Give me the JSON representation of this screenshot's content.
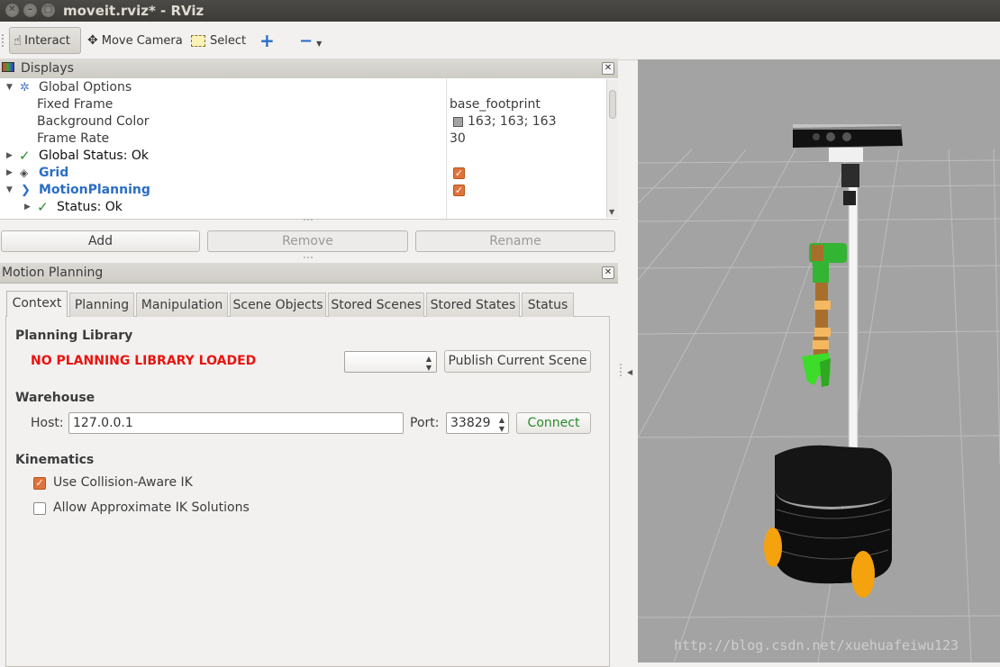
{
  "window": {
    "title": "moveit.rviz* - RViz"
  },
  "toolbar": {
    "interact": "Interact",
    "move_camera": "Move Camera",
    "select": "Select"
  },
  "displays": {
    "header": "Displays",
    "rows": {
      "global_options": "Global Options",
      "fixed_frame": {
        "label": "Fixed Frame",
        "value": "base_footprint"
      },
      "background_color": {
        "label": "Background Color",
        "value": "163; 163; 163",
        "swatch": "#a3a3a3"
      },
      "frame_rate": {
        "label": "Frame Rate",
        "value": "30"
      },
      "global_status": "Global Status: Ok",
      "grid": "Grid",
      "motion_planning": "MotionPlanning",
      "status": "Status: Ok"
    },
    "buttons": {
      "add": "Add",
      "remove": "Remove",
      "rename": "Rename"
    }
  },
  "motion_planning": {
    "header": "Motion Planning",
    "tabs": [
      "Context",
      "Planning",
      "Manipulation",
      "Scene Objects",
      "Stored Scenes",
      "Stored States",
      "Status"
    ],
    "active_tab": "Context",
    "planning_library": {
      "title": "Planning Library",
      "warning": "NO PLANNING LIBRARY LOADED",
      "publish_button": "Publish Current Scene"
    },
    "warehouse": {
      "title": "Warehouse",
      "host_label": "Host:",
      "host_value": "127.0.0.1",
      "port_label": "Port:",
      "port_value": "33829",
      "connect_button": "Connect"
    },
    "kinematics": {
      "title": "Kinematics",
      "collision_aware_ik": {
        "label": "Use Collision-Aware IK",
        "checked": true
      },
      "approx_ik": {
        "label": "Allow Approximate IK Solutions",
        "checked": false
      }
    }
  },
  "view3d": {
    "watermark": "http://blog.csdn.net/xuehuafeiwu123",
    "background": "#a3a3a3"
  },
  "colors": {
    "accent_blue": "#2a6ec6",
    "warning_red": "#e8140f",
    "checkbox_orange": "#e0733b",
    "connect_green": "#2a8a2a"
  }
}
